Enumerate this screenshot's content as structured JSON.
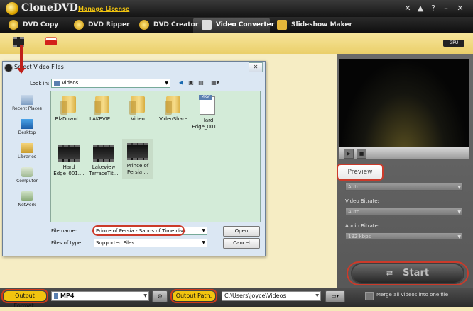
{
  "app": {
    "title": "CloneDVD",
    "manage_license": "Manage License"
  },
  "nav": [
    {
      "label": "DVD Copy"
    },
    {
      "label": "DVD Ripper"
    },
    {
      "label": "DVD Creator"
    },
    {
      "label": "Video Converter"
    },
    {
      "label": "Slideshow Maker"
    }
  ],
  "toolbar": {
    "youtube_text": "You Tube",
    "gpu_badge": "GPU"
  },
  "dialog": {
    "title": "Select Video Files",
    "look_in_label": "Look in:",
    "look_in_value": "Videos",
    "places": [
      {
        "label": "Recent Places"
      },
      {
        "label": "Desktop"
      },
      {
        "label": "Libraries"
      },
      {
        "label": "Computer"
      },
      {
        "label": "Network"
      }
    ],
    "files": [
      {
        "name": "BlzDownl...",
        "kind": "folder"
      },
      {
        "name": "LAKEVIE...",
        "kind": "folder"
      },
      {
        "name": "Video",
        "kind": "folder"
      },
      {
        "name": "VideoShare",
        "kind": "folder"
      },
      {
        "name": "Hard Edge_001....",
        "kind": "mkv"
      },
      {
        "name": "Hard Edge_001....",
        "kind": "video"
      },
      {
        "name": "Lakeview TerraceTit...",
        "kind": "video"
      },
      {
        "name": "Prince of Persia ...",
        "kind": "video"
      }
    ],
    "mkv_tag": "MKV",
    "file_name_label": "File name:",
    "file_name_value": "Prince of Persia - Sands of Time.divx",
    "files_of_type_label": "Files of type:",
    "files_of_type_value": "Supported Files",
    "open_label": "Open",
    "cancel_label": "Cancel"
  },
  "right_panel": {
    "preview_label": "Preview",
    "select_1": "Auto",
    "video_bitrate_label": "Video Bitrate:",
    "video_bitrate_value": "Auto",
    "audio_bitrate_label": "Audio Bitrate:",
    "audio_bitrate_value": "192 kbps",
    "start_label": "Start"
  },
  "bottom": {
    "output_format_label": "Output Format:",
    "output_format_value": "MP4",
    "output_path_label": "Output Path:",
    "output_path_value": "C:\\Users\\Joyce\\Videos",
    "merge_label": "Merge all videos into one file"
  }
}
